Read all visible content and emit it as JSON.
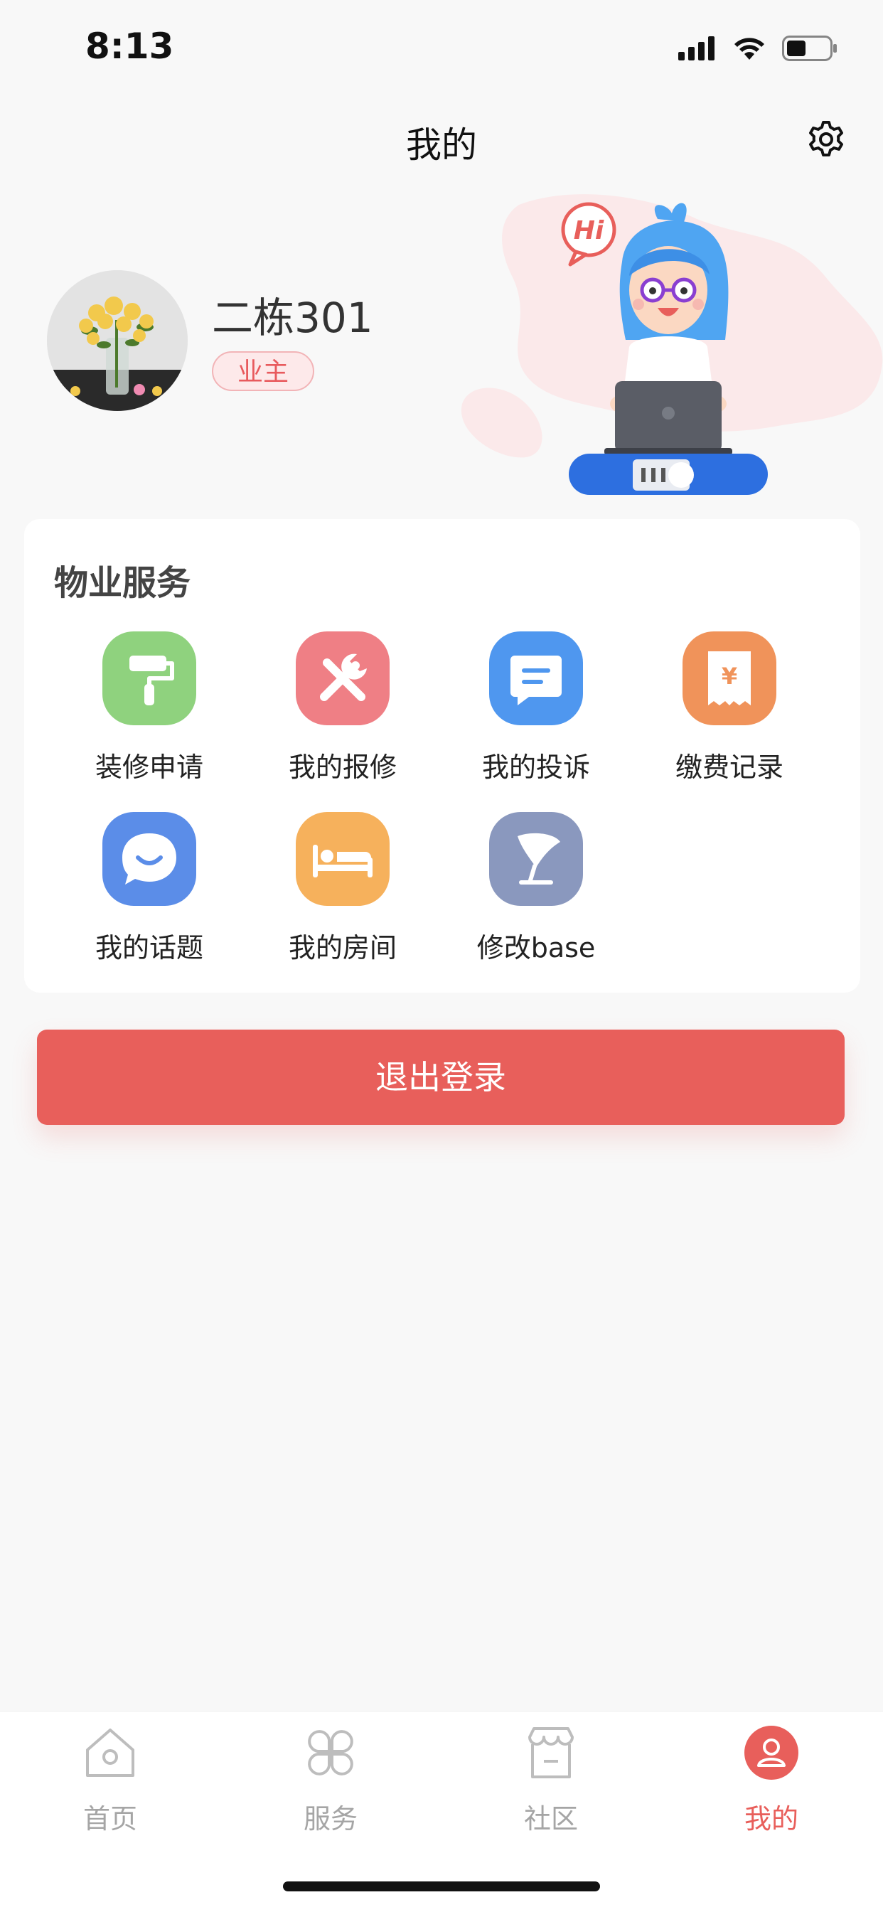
{
  "status_bar": {
    "time": "8:13"
  },
  "header": {
    "title": "我的"
  },
  "profile": {
    "name": "二栋301",
    "role": "业主"
  },
  "illustration": {
    "greeting": "Hi"
  },
  "services": {
    "title": "物业服务",
    "items": [
      {
        "label": "装修申请",
        "icon": "paint-roller-icon",
        "color": "#8fd27e"
      },
      {
        "label": "我的报修",
        "icon": "wrench-icon",
        "color": "#ef7f85"
      },
      {
        "label": "我的投诉",
        "icon": "message-icon",
        "color": "#4f97ef"
      },
      {
        "label": "缴费记录",
        "icon": "receipt-icon",
        "color": "#f0935a"
      },
      {
        "label": "我的话题",
        "icon": "chat-bubble-icon",
        "color": "#5b8de8"
      },
      {
        "label": "我的房间",
        "icon": "bed-icon",
        "color": "#f6b15c"
      },
      {
        "label": "修改base",
        "icon": "pen-icon",
        "color": "#8a98be"
      }
    ]
  },
  "logout": {
    "label": "退出登录"
  },
  "tabs": [
    {
      "label": "首页",
      "icon": "home-icon",
      "active": false
    },
    {
      "label": "服务",
      "icon": "clover-icon",
      "active": false
    },
    {
      "label": "社区",
      "icon": "shop-icon",
      "active": false
    },
    {
      "label": "我的",
      "icon": "profile-icon",
      "active": true
    }
  ],
  "colors": {
    "accent": "#e85f5b",
    "background": "#f8f8f8"
  }
}
